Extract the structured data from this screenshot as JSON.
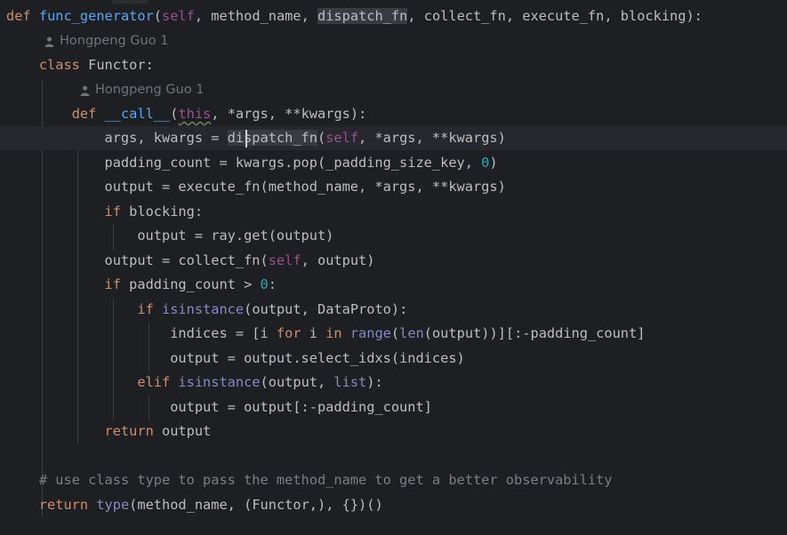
{
  "colors": {
    "background": "#1e1f22",
    "keyword": "#cf8e6d",
    "function": "#56a8f5",
    "builtin": "#8888c6",
    "number": "#2aacb8",
    "comment": "#7a7e85",
    "self": "#94558d",
    "text": "#bcbec4"
  },
  "hint_icon": "person-icon",
  "author_hints": [
    {
      "text": "Hongpeng Guo 1"
    },
    {
      "text": "Hongpeng Guo 1"
    }
  ],
  "code_lines": [
    [
      {
        "t": "def",
        "c": "kw"
      },
      {
        "t": " "
      },
      {
        "t": "func_generator",
        "c": "fn"
      },
      {
        "t": "("
      },
      {
        "t": "self",
        "c": "self"
      },
      {
        "t": ", method_name, "
      },
      {
        "t": "dispatch_fn",
        "c": "df"
      },
      {
        "t": ", collect_fn, execute_fn, blocking):"
      }
    ],
    [
      {
        "t": "    "
      },
      {
        "t": "class",
        "c": "kw"
      },
      {
        "t": " Functor:"
      }
    ],
    [
      {
        "t": "        "
      },
      {
        "t": "def",
        "c": "kw"
      },
      {
        "t": " "
      },
      {
        "t": "__call__",
        "c": "fn"
      },
      {
        "t": "("
      },
      {
        "t": "this",
        "c": "self wavy"
      },
      {
        "t": ", *args, **kwargs):"
      }
    ],
    [
      {
        "t": "            args, kwargs = "
      },
      {
        "t": "dispatch_fn",
        "c": "df"
      },
      {
        "t": "("
      },
      {
        "t": "self",
        "c": "self"
      },
      {
        "t": ", *args, **kwargs)"
      }
    ],
    [
      {
        "t": "            padding_count = kwargs.pop(_padding_size_key, "
      },
      {
        "t": "0",
        "c": "num"
      },
      {
        "t": ")"
      }
    ],
    [
      {
        "t": "            output = execute_fn(method_name, *args, **kwargs)"
      }
    ],
    [
      {
        "t": "            "
      },
      {
        "t": "if",
        "c": "kw"
      },
      {
        "t": " blocking:"
      }
    ],
    [
      {
        "t": "                output = ray.get(output)"
      }
    ],
    [
      {
        "t": "            output = collect_fn("
      },
      {
        "t": "self",
        "c": "self"
      },
      {
        "t": ", output)"
      }
    ],
    [
      {
        "t": "            "
      },
      {
        "t": "if",
        "c": "kw"
      },
      {
        "t": " padding_count > "
      },
      {
        "t": "0",
        "c": "num"
      },
      {
        "t": ":"
      }
    ],
    [
      {
        "t": "                "
      },
      {
        "t": "if",
        "c": "kw"
      },
      {
        "t": " "
      },
      {
        "t": "isinstance",
        "c": "bi"
      },
      {
        "t": "(output, DataProto):"
      }
    ],
    [
      {
        "t": "                    indices = [i "
      },
      {
        "t": "for",
        "c": "kw"
      },
      {
        "t": " i "
      },
      {
        "t": "in",
        "c": "kw"
      },
      {
        "t": " "
      },
      {
        "t": "range",
        "c": "bi"
      },
      {
        "t": "("
      },
      {
        "t": "len",
        "c": "bi"
      },
      {
        "t": "(output))][:-padding_count]"
      }
    ],
    [
      {
        "t": "                    output = output.select_idxs(indices)"
      }
    ],
    [
      {
        "t": "                "
      },
      {
        "t": "elif",
        "c": "kw"
      },
      {
        "t": " "
      },
      {
        "t": "isinstance",
        "c": "bi"
      },
      {
        "t": "(output, "
      },
      {
        "t": "list",
        "c": "bi"
      },
      {
        "t": "):"
      }
    ],
    [
      {
        "t": "                    output = output[:-padding_count]"
      }
    ],
    [
      {
        "t": "            "
      },
      {
        "t": "return",
        "c": "kw"
      },
      {
        "t": " output"
      }
    ],
    [
      {
        "t": ""
      }
    ],
    [
      {
        "t": "    "
      },
      {
        "t": "# use class type to pass the method_name to get a better observability",
        "c": "cm"
      }
    ],
    [
      {
        "t": "    "
      },
      {
        "t": "return",
        "c": "kw"
      },
      {
        "t": " "
      },
      {
        "t": "type",
        "c": "bi"
      },
      {
        "t": "(method_name, (Functor,), {})()"
      }
    ]
  ]
}
